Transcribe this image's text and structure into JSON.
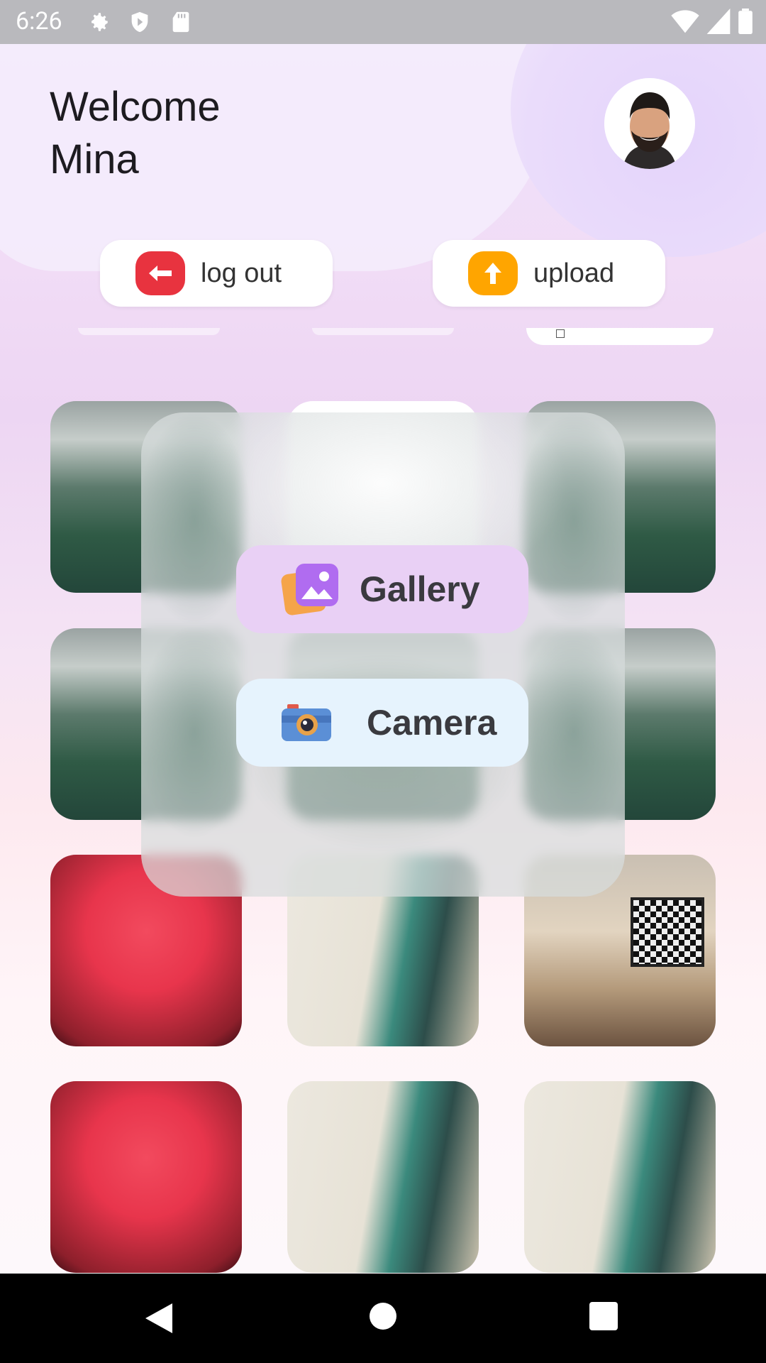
{
  "status_bar": {
    "time": "6:26",
    "icons_left": [
      "gear-icon",
      "shield-icon",
      "sd-card-icon"
    ],
    "icons_right": [
      "wifi-icon",
      "signal-icon",
      "battery-icon"
    ]
  },
  "header": {
    "greeting": "Welcome",
    "username": "Mina",
    "avatar": "profile-avatar"
  },
  "actions": {
    "logout_label": "log out",
    "upload_label": "upload",
    "logout_color": "#e8333f",
    "upload_color": "#ffa500"
  },
  "grid": {
    "tiles": [
      "landscape",
      "landscape",
      "landscape",
      "landscape",
      "landscape",
      "landscape",
      "valorant",
      "agent",
      "room",
      "valorant",
      "agent",
      "agent"
    ]
  },
  "picker": {
    "gallery_label": "Gallery",
    "camera_label": "Camera",
    "gallery_bg": "#e9d0f5",
    "camera_bg": "#e6f3fd"
  },
  "nav": {
    "buttons": [
      "back-icon",
      "home-icon",
      "recents-icon"
    ]
  }
}
